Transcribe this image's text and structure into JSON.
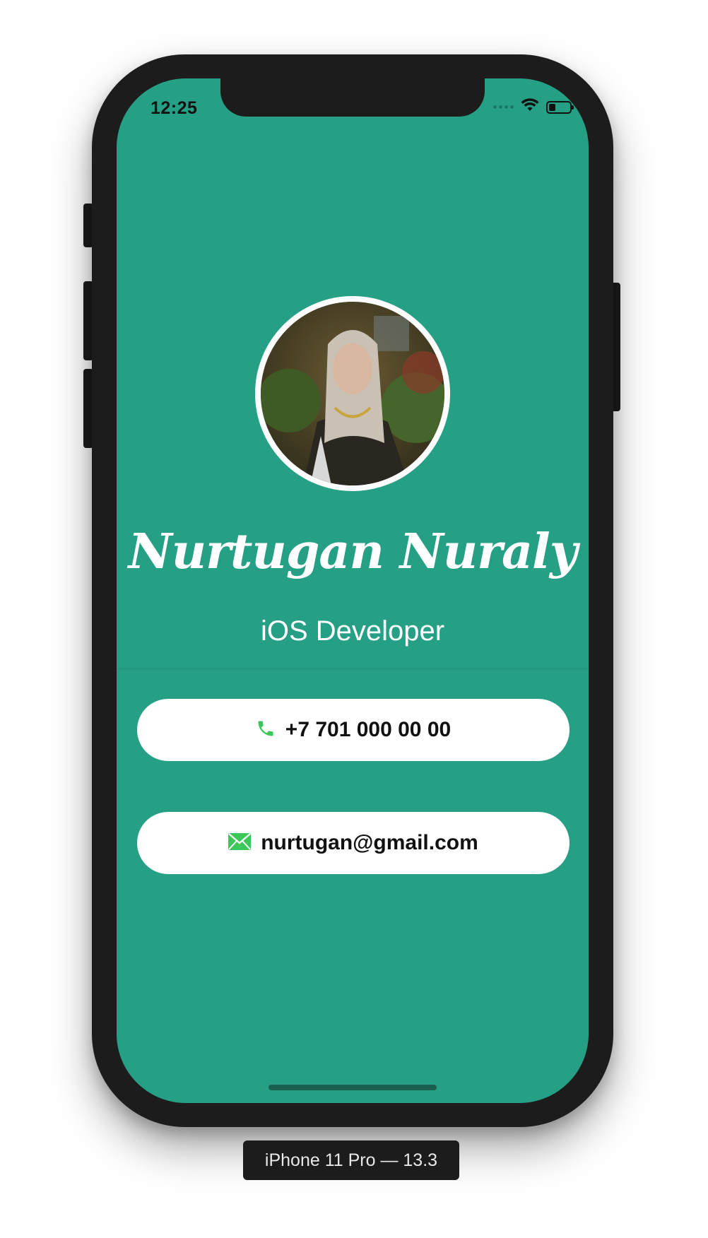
{
  "status_bar": {
    "time": "12:25",
    "icons": [
      "signal-icon",
      "wifi-icon",
      "battery-icon"
    ]
  },
  "profile": {
    "name": "Nurtugan Nuraly",
    "title": "iOS Developer",
    "avatar_alt": "profile-photo"
  },
  "contacts": {
    "phone": "+7 701 000 00 00",
    "email": "nurtugan@gmail.com"
  },
  "simulator": {
    "device_label": "iPhone 11 Pro — 13.3"
  },
  "colors": {
    "background": "#26a085",
    "pill": "#ffffff",
    "icon_green": "#3cc75b"
  }
}
